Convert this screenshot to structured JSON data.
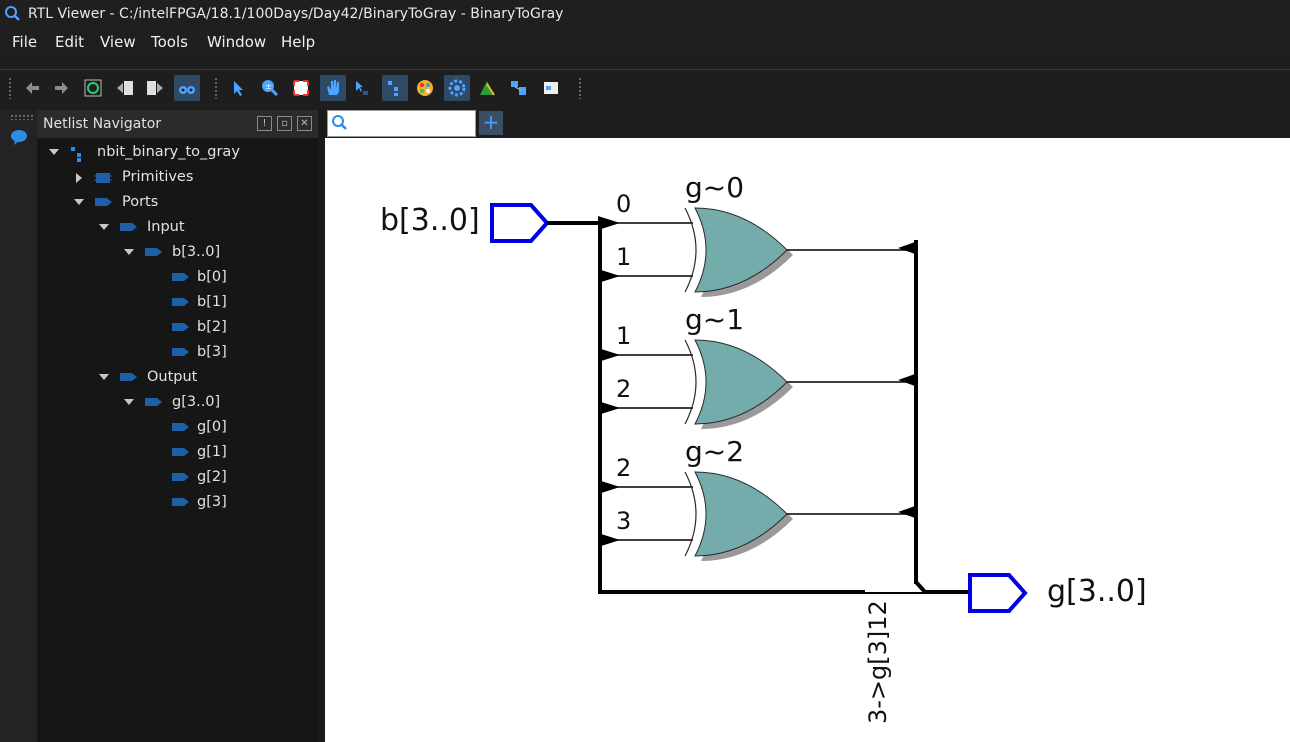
{
  "window": {
    "title": "RTL Viewer - C:/intelFPGA/18.1/100Days/Day42/BinaryToGray - BinaryToGray"
  },
  "menu": [
    "File",
    "Edit",
    "View",
    "Tools",
    "Window",
    "Help"
  ],
  "toolbar": {
    "buttons": [
      "back-icon",
      "forward-icon",
      "refresh-icon",
      "hierarchy-up-icon",
      "hierarchy-down-icon",
      "binoculars-icon",
      "select-icon",
      "zoom-icon",
      "fit-icon",
      "hand-icon",
      "pointer-icon",
      "netlist-icon",
      "color-icon",
      "settings-icon",
      "highlight-icon",
      "filter-icon",
      "export-icon"
    ]
  },
  "navigator": {
    "title": "Netlist Navigator",
    "root": "nbit_binary_to_gray",
    "primitives": "Primitives",
    "ports": "Ports",
    "input": "Input",
    "input_bus": "b[3..0]",
    "inputs": [
      "b[0]",
      "b[1]",
      "b[2]",
      "b[3]"
    ],
    "output": "Output",
    "output_bus": "g[3..0]",
    "outputs": [
      "g[0]",
      "g[1]",
      "g[2]",
      "g[3]"
    ]
  },
  "schematic": {
    "input_port": "b[3..0]",
    "output_port": "g[3..0]",
    "gates": [
      {
        "name": "g~0",
        "in_a": "0",
        "in_b": "1"
      },
      {
        "name": "g~1",
        "in_a": "1",
        "in_b": "2"
      },
      {
        "name": "g~2",
        "in_a": "2",
        "in_b": "3"
      }
    ],
    "bus_label": "3->g[3]12"
  },
  "colors": {
    "gate_fill": "#74acac",
    "port_stroke": "#0000e0",
    "accent": "#2f4a66"
  }
}
